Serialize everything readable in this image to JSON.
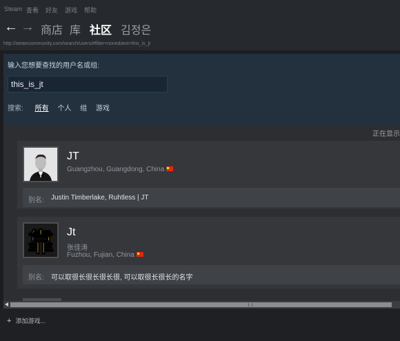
{
  "menu": [
    "Steam",
    "查看",
    "好友",
    "游戏",
    "帮助"
  ],
  "nav": {
    "back_arrow": "←",
    "forward_arrow": "→",
    "tabs": [
      "商店",
      "库",
      "社区",
      "김정은"
    ],
    "active_tab": "社区"
  },
  "url": "http://steamcommunity.com/search/users/#filter=none&text=this_is_jt",
  "search": {
    "prompt": "输入您想要查找的用户名或组:",
    "value": "this_is_jt",
    "filter_label": "搜索:",
    "filters": [
      "所有",
      "个人",
      "组",
      "游戏"
    ],
    "active_filter": "所有"
  },
  "results": {
    "showing_text": "正在显示",
    "items": [
      {
        "name": "JT",
        "real_name": "",
        "location": "Guangzhou, Guangdong, China",
        "alias_label": "别名:",
        "aliases": "Justin Timberlake, Ruhtless | JT",
        "avatar_icon": "person-photo-avatar",
        "flag": "china-flag-icon"
      },
      {
        "name": "Jt",
        "real_name": "张佳涛",
        "location": "Fuzhou, Fujian, China",
        "alias_label": "别名:",
        "aliases": "可以取很长很长很长很, 可以取很长很长的名字",
        "avatar_glyph": "靠",
        "avatar_icon": "glyph-avatar",
        "flag": "china-flag-icon"
      }
    ]
  },
  "footer": {
    "add_game_icon": "+",
    "add_game": "添加游戏..."
  },
  "colors": {
    "chrome": "#262a2e",
    "search_panel": "#23303e",
    "card": "#35373a",
    "alias_row": "#3f4246",
    "avatar_yellow": "#f2c200"
  }
}
